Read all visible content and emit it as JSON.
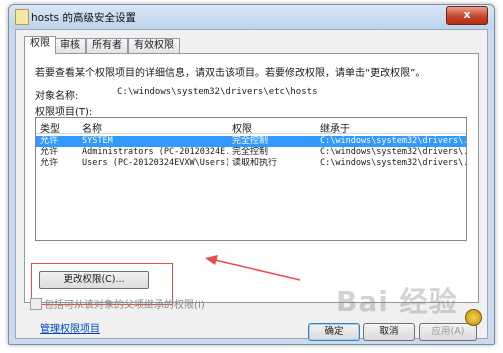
{
  "window": {
    "title": "hosts 的高级安全设置",
    "close_glyph": "x"
  },
  "tabs": [
    "权限",
    "审核",
    "所有者",
    "有效权限"
  ],
  "description": "若要查看某个权限项目的详细信息，请双击该项目。若要修改权限，请单击“更改权限”。",
  "object": {
    "label": "对象名称:",
    "value": "C:\\windows\\system32\\drivers\\etc\\hosts"
  },
  "entries_label": "权限项目(T):",
  "table": {
    "columns": [
      "类型",
      "名称",
      "权限",
      "继承于"
    ],
    "rows": [
      {
        "type": "允许",
        "name": "SYSTEM",
        "permission": "完全控制",
        "inherited_from": "C:\\windows\\system32\\drivers\\...",
        "selected": true
      },
      {
        "type": "允许",
        "name": "Administrators (PC-20120324E...",
        "permission": "完全控制",
        "inherited_from": "C:\\windows\\system32\\drivers\\...",
        "selected": false
      },
      {
        "type": "允许",
        "name": "Users (PC-20120324EVXW\\Users)",
        "permission": "读取和执行",
        "inherited_from": "C:\\windows\\system32\\drivers\\...",
        "selected": false
      }
    ]
  },
  "change_permissions_button": "更改权限(C)...",
  "inherit_checkbox_label": "包括可从该对象的父项继承的权限(I)",
  "manage_link": "管理权限项目",
  "buttons": {
    "ok": "确定",
    "cancel": "取消",
    "apply": "应用(A)"
  },
  "watermark": "Bai 经验",
  "colors": {
    "selection": "#3399ff",
    "annotation": "#e84c4c",
    "link": "#0046c8"
  }
}
